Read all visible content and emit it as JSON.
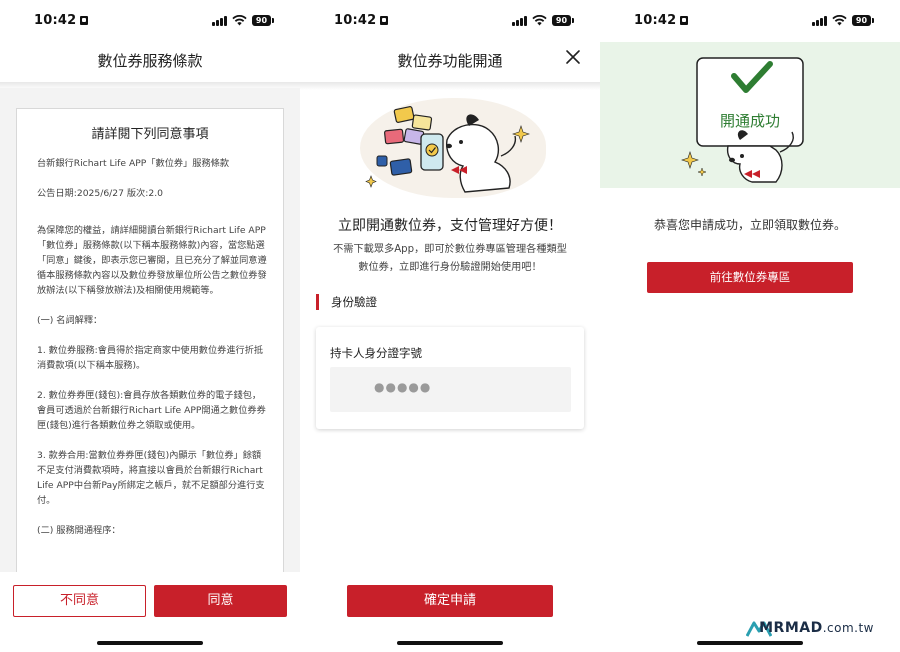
{
  "status_bar": {
    "time": "10:42",
    "battery": "90"
  },
  "panel1": {
    "title": "數位券服務條款",
    "terms_heading": "請詳閱下列同意事項",
    "paragraphs": [
      "台新銀行Richart Life APP「數位券」服務條款",
      "公告日期:2025/6/27 版次:2.0",
      "為保障您的權益，請詳細閱讀台新銀行Richart Life APP「數位券」服務條款(以下稱本服務條款)內容，當您點選「同意」鍵後，即表示您已審閱，且已充分了解並同意遵循本服務條款內容以及數位券發放單位所公告之數位券發放辦法(以下稱發放辦法)及相關使用規範等。",
      "(一) 名詞解釋：",
      "1. 數位券服務:會員得於指定商家中使用數位券進行折抵消費款項(以下稱本服務)。",
      "2. 數位券券匣(錢包):會員存放各類數位券的電子錢包，會員可透過於台新銀行Richart Life APP開通之數位券券匣(錢包)進行各類數位券之領取或使用。",
      "3. 款券合用:當數位券券匣(錢包)內顯示「數位券」餘額不足支付消費款項時，將直接以會員於台新銀行Richart Life APP中台新Pay所綁定之帳戶，就不足額部分進行支付。",
      "(二) 服務開通程序："
    ],
    "disagree_label": "不同意",
    "agree_label": "同意"
  },
  "panel2": {
    "title": "數位券功能開通",
    "headline": "立即開通數位券，支付管理好方便！",
    "description": "不需下載眾多App，即可於數位券專區管理各種類型數位券，立即進行身份驗證開始使用吧！",
    "section_title": "身份驗證",
    "field_label": "持卡人身分證字號",
    "field_value": "●●●●●",
    "submit_label": "確定申請"
  },
  "panel3": {
    "sign_text": "開通成功",
    "message": "恭喜您申請成功，立即領取數位券。",
    "button_label": "前往數位券專區"
  },
  "watermark": {
    "brand": "MRMAD",
    "domain": ".com.tw"
  },
  "colors": {
    "accent_red": "#c8202a",
    "success_green": "#2e7d32",
    "hero_green": "#e9f4e8"
  },
  "icons": [
    "lock-icon",
    "signal-icon",
    "wifi-icon",
    "battery-icon",
    "close-icon",
    "coupon-icon",
    "phone-check-icon",
    "dog-mascot-icon",
    "sparkle-icon",
    "checkmark-icon",
    "mrmad-logo-icon"
  ]
}
